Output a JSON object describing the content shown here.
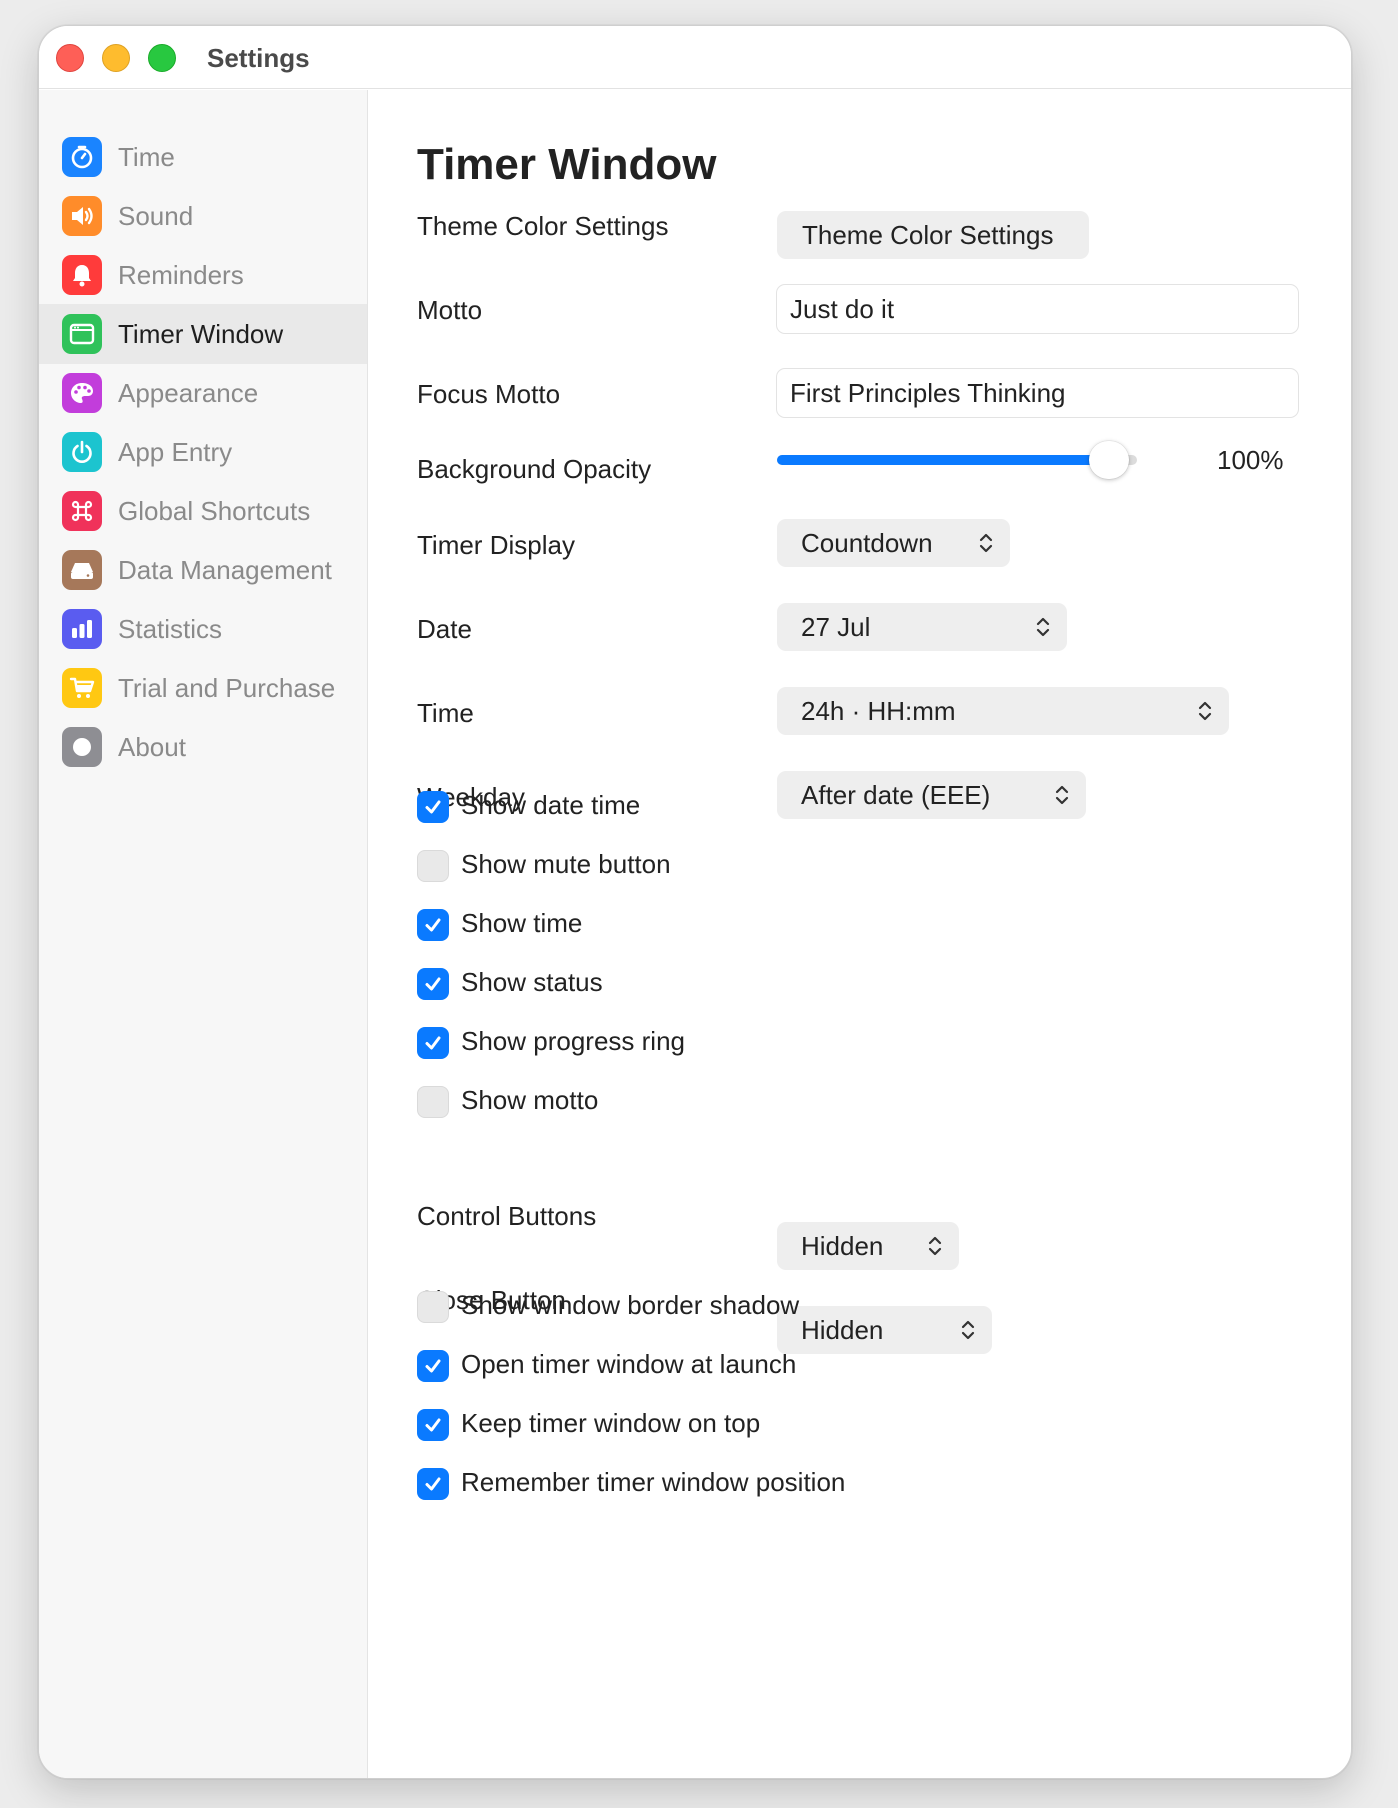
{
  "window": {
    "title": "Settings"
  },
  "sidebar": {
    "items": [
      {
        "label": "Time",
        "icon": "timer-icon",
        "color": "#1a84ff",
        "active": false
      },
      {
        "label": "Sound",
        "icon": "speaker-icon",
        "color": "#ff8c2a",
        "active": false
      },
      {
        "label": "Reminders",
        "icon": "bell-icon",
        "color": "#ff3b3b",
        "active": false
      },
      {
        "label": "Timer Window",
        "icon": "window-icon",
        "color": "#2fc25a",
        "active": true
      },
      {
        "label": "Appearance",
        "icon": "palette-icon",
        "color": "#c23ddb",
        "active": false
      },
      {
        "label": "App Entry",
        "icon": "power-icon",
        "color": "#1cc4cf",
        "active": false
      },
      {
        "label": "Global Shortcuts",
        "icon": "command-icon",
        "color": "#f0325a",
        "active": false
      },
      {
        "label": "Data Management",
        "icon": "drive-icon",
        "color": "#a6785a",
        "active": false
      },
      {
        "label": "Statistics",
        "icon": "bar-chart-icon",
        "color": "#5a5cf0",
        "active": false
      },
      {
        "label": "Trial and Purchase",
        "icon": "cart-icon",
        "color": "#ffc812",
        "active": false
      },
      {
        "label": "About",
        "icon": "circle-icon",
        "color": "#8e8e93",
        "active": false
      }
    ]
  },
  "main": {
    "title": "Timer Window",
    "theme_color": {
      "label": "Theme Color Settings",
      "button_label": "Theme Color Settings"
    },
    "motto": {
      "label": "Motto",
      "value": "Just do it"
    },
    "focus_motto": {
      "label": "Focus Motto",
      "value": "First Principles Thinking"
    },
    "background_opacity": {
      "label": "Background Opacity",
      "value_text": "100%",
      "fraction": 1.0
    },
    "timer_display": {
      "label": "Timer Display",
      "value": "Countdown"
    },
    "date": {
      "label": "Date",
      "value": "27 Jul"
    },
    "time": {
      "label": "Time",
      "value": "24h · HH:mm"
    },
    "weekday": {
      "label": "Weekday",
      "value": "After date (EEE)"
    },
    "checks_a": [
      {
        "label": "Show date time",
        "checked": true
      },
      {
        "label": "Show mute button",
        "checked": false
      },
      {
        "label": "Show time",
        "checked": true
      },
      {
        "label": "Show status",
        "checked": true
      },
      {
        "label": "Show progress ring",
        "checked": true
      },
      {
        "label": "Show motto",
        "checked": false
      }
    ],
    "control_buttons": {
      "label": "Control Buttons",
      "value": "Hidden"
    },
    "close_button": {
      "label": "Close Button",
      "value": "Hidden"
    },
    "checks_b": [
      {
        "label": "Show window border shadow",
        "checked": false
      },
      {
        "label": "Open timer window at launch",
        "checked": true
      },
      {
        "label": "Keep timer window on top",
        "checked": true
      },
      {
        "label": "Remember timer window position",
        "checked": true
      }
    ]
  },
  "colors": {
    "accent": "#0a7aff"
  }
}
